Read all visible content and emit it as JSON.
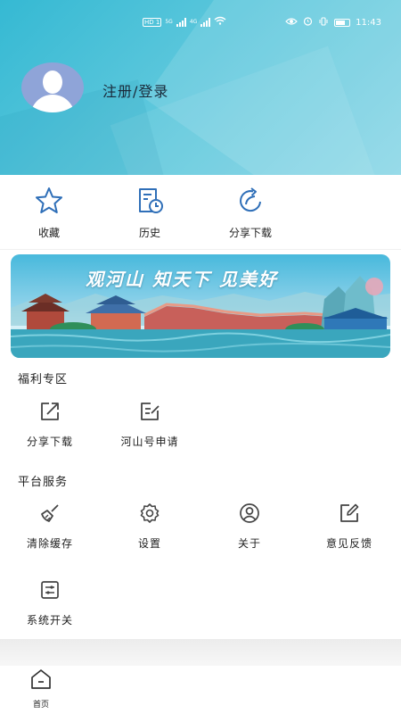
{
  "status_bar": {
    "hd1": "HD 1",
    "hd2": "HD 2",
    "net1": "5G",
    "net2": "4G",
    "time": "11:43"
  },
  "profile": {
    "login_label": "注册/登录"
  },
  "quick_actions": [
    {
      "label": "收藏",
      "icon": "star-icon"
    },
    {
      "label": "历史",
      "icon": "history-icon"
    },
    {
      "label": "分享下载",
      "icon": "share-icon"
    }
  ],
  "banner": {
    "title": "观河山  知天下  见美好"
  },
  "welfare": {
    "title": "福利专区",
    "items": [
      {
        "label": "分享下载",
        "icon": "share-out-icon"
      },
      {
        "label": "河山号申请",
        "icon": "edit-note-icon"
      }
    ]
  },
  "services": {
    "title": "平台服务",
    "items": [
      {
        "label": "清除缓存",
        "icon": "broom-icon"
      },
      {
        "label": "设置",
        "icon": "gear-icon"
      },
      {
        "label": "关于",
        "icon": "user-circle-icon"
      },
      {
        "label": "意见反馈",
        "icon": "pencil-square-icon"
      },
      {
        "label": "系统开关",
        "icon": "toggle-icon"
      }
    ]
  },
  "bottom_nav": {
    "home_label": "首页"
  },
  "colors": {
    "header_gradient_start": "#35b9d3",
    "header_gradient_end": "#8ad6e6",
    "icon_blue": "#2f6fb8",
    "icon_gray": "#444444"
  }
}
